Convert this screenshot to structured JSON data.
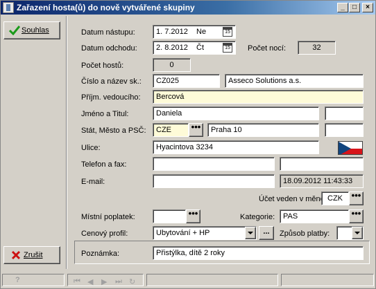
{
  "window": {
    "title": "Zařazení hosta(ů) do nově vytvářené skupiny",
    "controls": {
      "minimize": "_",
      "maximize": "□",
      "close": "×"
    }
  },
  "actions": {
    "confirm_label": "Souhlas",
    "cancel_label": "Zrušit"
  },
  "form": {
    "arrival": {
      "label": "Datum nástupu:",
      "date": "1. 7.2012",
      "day": "Ne"
    },
    "departure": {
      "label": "Datum odchodu:",
      "date": "2. 8.2012",
      "day": "Čt"
    },
    "nights": {
      "label": "Počet nocí:",
      "value": "32"
    },
    "guests": {
      "label": "Počet hostů:",
      "value": "0"
    },
    "company": {
      "label": "Číslo a název sk.:",
      "number": "CZ025",
      "name": "Asseco Solutions a.s."
    },
    "leader_surname": {
      "label": "Příjm. vedoucího:",
      "value": "Bercová"
    },
    "name_title": {
      "label": "Jméno a Titul:",
      "name": "Daniela",
      "title": ""
    },
    "country_city_zip": {
      "label": "Stát, Město a PSČ:",
      "country": "CZE",
      "city": "Praha 10",
      "zip": ""
    },
    "street": {
      "label": "Ulice:",
      "value": "Hyacintova 3234"
    },
    "phone_fax": {
      "label": "Telefon a fax:",
      "phone": "",
      "fax": ""
    },
    "email": {
      "label": "E-mail:",
      "value": "",
      "timestamp": "18.09.2012 11:43:33"
    },
    "account_currency": {
      "label": "Účet veden v měně:",
      "value": "CZK"
    },
    "local_fee": {
      "label": "Místní poplatek:",
      "value": ""
    },
    "category": {
      "label": "Kategorie:",
      "value": "PAS"
    },
    "price_profile": {
      "label": "Cenový profil:",
      "value": "Ubytování + HP"
    },
    "payment_method": {
      "label": "Způsob platby:",
      "value": ""
    },
    "note": {
      "label": "Poznámka:",
      "value": "Přistýlka, dítě 2 roky"
    }
  },
  "ui": {
    "lookup_glyph": "•••",
    "ellipsis_glyph": "...",
    "calendar_glyph": "15",
    "help_glyph": "?",
    "nav_glyphs": [
      "⏮",
      "◀",
      "▶",
      "⏭",
      "↻"
    ]
  },
  "colors": {
    "titlebar_start": "#0a246a",
    "titlebar_end": "#a6caf0",
    "highlight_field": "#fefbd8",
    "confirm_check": "#1a9a1a",
    "cancel_x": "#cc1111"
  }
}
